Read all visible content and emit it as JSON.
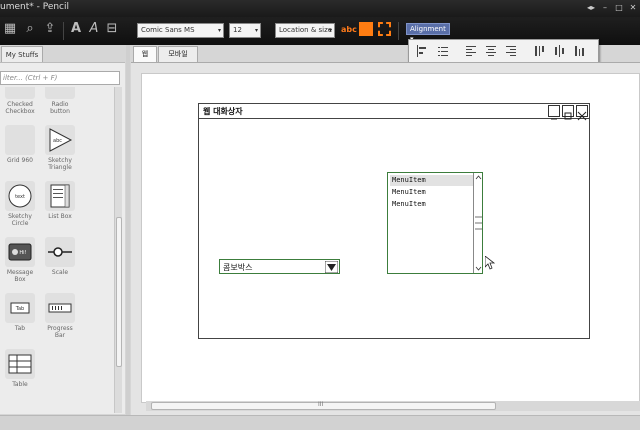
{
  "window": {
    "title": "ument* - Pencil",
    "controls": [
      "◂▸",
      "–",
      "□",
      "✕"
    ]
  },
  "toolbar": {
    "font_family": "Comic Sans MS",
    "font_size": "12",
    "location_size": "Location & size",
    "text_color_label": "abc",
    "accent_color": "#ff7d12",
    "alignment_label": "Alignment"
  },
  "left_panel": {
    "tab": "My Stuffs",
    "filter_placeholder": "ilter... (Ctrl + F)",
    "stencils": [
      {
        "label": "Checked\nCheckbox",
        "icon": "checkbox-icon"
      },
      {
        "label": "Radio\nbutton",
        "icon": "radio-icon"
      },
      {
        "label": "Grid 960",
        "icon": "grid-icon"
      },
      {
        "label": "Sketchy\nTriangle",
        "icon": "triangle-icon",
        "glyph": "abc"
      },
      {
        "label": "Sketchy\nCircle",
        "icon": "circle-icon",
        "glyph": "text"
      },
      {
        "label": "List Box",
        "icon": "listbox-icon"
      },
      {
        "label": "Message\nBox",
        "icon": "message-box-icon",
        "glyph": "Hi!"
      },
      {
        "label": "Scale",
        "icon": "scale-icon"
      },
      {
        "label": "Tab",
        "icon": "tab-icon",
        "glyph": "Tab"
      },
      {
        "label": "Progress\nBar",
        "icon": "progress-bar-icon"
      },
      {
        "label": "Table",
        "icon": "table-icon"
      }
    ]
  },
  "page_tabs": [
    "웹",
    "모바일"
  ],
  "canvas": {
    "dialog_title": "웹 대화상자",
    "combo_text": "콤보박스",
    "list_items": [
      "MenuItem",
      "MenuItem",
      "MenuItem"
    ],
    "selected_index": 0
  },
  "hscroll_grip": "III"
}
